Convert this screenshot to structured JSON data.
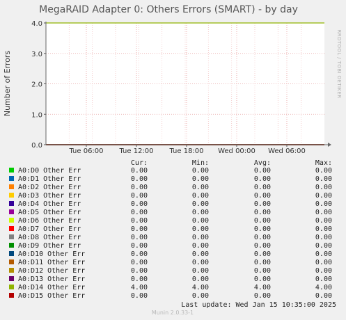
{
  "chart_data": {
    "type": "line",
    "title": "MegaRAID Adapter 0: Others Errors (SMART) - by day",
    "ylabel": "Number of Errors",
    "xlabel": "",
    "ylim": [
      0,
      4
    ],
    "y_ticks": [
      "0.0",
      "1.0",
      "2.0",
      "3.0",
      "4.0"
    ],
    "x_ticks": [
      "Tue 06:00",
      "Tue 12:00",
      "Tue 18:00",
      "Wed 00:00",
      "Wed 06:00"
    ],
    "grid": true,
    "side_label": "RRDTOOL / TOBI OETIKER",
    "columns": [
      "Cur:",
      "Min:",
      "Avg:",
      "Max:"
    ],
    "series": [
      {
        "name": "A0:D0 Other Err",
        "color": "#00cc00",
        "cur": "0.00",
        "min": "0.00",
        "avg": "0.00",
        "max": "0.00",
        "value": 0
      },
      {
        "name": "A0:D1 Other Err",
        "color": "#0066b3",
        "cur": "0.00",
        "min": "0.00",
        "avg": "0.00",
        "max": "0.00",
        "value": 0
      },
      {
        "name": "A0:D2 Other Err",
        "color": "#ff8000",
        "cur": "0.00",
        "min": "0.00",
        "avg": "0.00",
        "max": "0.00",
        "value": 0
      },
      {
        "name": "A0:D3 Other Err",
        "color": "#ffcc00",
        "cur": "0.00",
        "min": "0.00",
        "avg": "0.00",
        "max": "0.00",
        "value": 0
      },
      {
        "name": "A0:D4 Other Err",
        "color": "#330099",
        "cur": "0.00",
        "min": "0.00",
        "avg": "0.00",
        "max": "0.00",
        "value": 0
      },
      {
        "name": "A0:D5 Other Err",
        "color": "#990099",
        "cur": "0.00",
        "min": "0.00",
        "avg": "0.00",
        "max": "0.00",
        "value": 0
      },
      {
        "name": "A0:D6 Other Err",
        "color": "#ccff00",
        "cur": "0.00",
        "min": "0.00",
        "avg": "0.00",
        "max": "0.00",
        "value": 0
      },
      {
        "name": "A0:D7 Other Err",
        "color": "#ff0000",
        "cur": "0.00",
        "min": "0.00",
        "avg": "0.00",
        "max": "0.00",
        "value": 0
      },
      {
        "name": "A0:D8 Other Err",
        "color": "#808080",
        "cur": "0.00",
        "min": "0.00",
        "avg": "0.00",
        "max": "0.00",
        "value": 0
      },
      {
        "name": "A0:D9 Other Err",
        "color": "#008f00",
        "cur": "0.00",
        "min": "0.00",
        "avg": "0.00",
        "max": "0.00",
        "value": 0
      },
      {
        "name": "A0:D10 Other Err",
        "color": "#00487d",
        "cur": "0.00",
        "min": "0.00",
        "avg": "0.00",
        "max": "0.00",
        "value": 0
      },
      {
        "name": "A0:D11 Other Err",
        "color": "#b35a00",
        "cur": "0.00",
        "min": "0.00",
        "avg": "0.00",
        "max": "0.00",
        "value": 0
      },
      {
        "name": "A0:D12 Other Err",
        "color": "#b38f00",
        "cur": "0.00",
        "min": "0.00",
        "avg": "0.00",
        "max": "0.00",
        "value": 0
      },
      {
        "name": "A0:D13 Other Err",
        "color": "#6b006b",
        "cur": "0.00",
        "min": "0.00",
        "avg": "0.00",
        "max": "0.00",
        "value": 0
      },
      {
        "name": "A0:D14 Other Err",
        "color": "#8fb300",
        "cur": "4.00",
        "min": "4.00",
        "avg": "4.00",
        "max": "4.00",
        "value": 4
      },
      {
        "name": "A0:D15 Other Err",
        "color": "#b30000",
        "cur": "0.00",
        "min": "0.00",
        "avg": "0.00",
        "max": "0.00",
        "value": 0
      }
    ],
    "last_update": "Last update:  Wed Jan 15 10:35:00 2025",
    "munin_version": "Munin 2.0.33-1"
  }
}
